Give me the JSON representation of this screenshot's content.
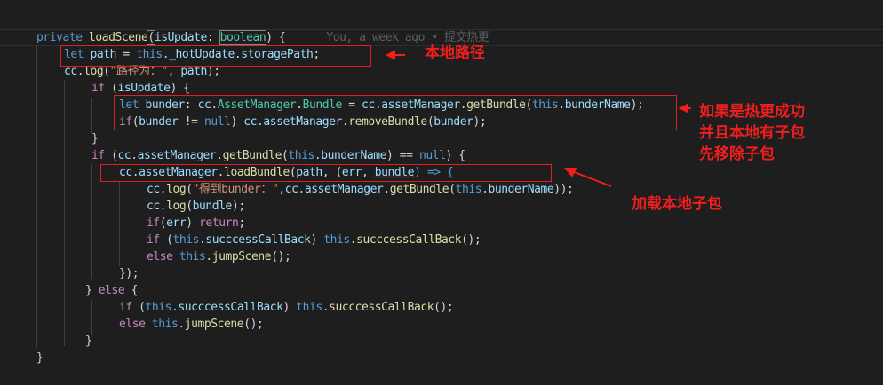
{
  "editor": {
    "blame": "You, a week ago • 提交热更",
    "lines": {
      "l1": {
        "kw": "private",
        "fn": "loadScene",
        "param": "isUpdate",
        "colon": ": ",
        "type": "boolean",
        "end": ") {"
      },
      "l2": {
        "kw": "let",
        "var": "path",
        "eq": " = ",
        "this": "this",
        "prop": "._hotUpdate.storagePath",
        "end": ";"
      },
      "l3": {
        "obj": "cc",
        "fn": ".log",
        "open": "(",
        "str": "\"路径为：\"",
        "mid": ", ",
        "arg": "path",
        "end": ");"
      },
      "l4": {
        "kw": "if",
        "open": " (",
        "arg": "isUpdate",
        "end": ") {"
      },
      "l5": {
        "kw": "let",
        "var": "bunder",
        "colon": ": ",
        "obj": "cc",
        "type1": "AssetManager",
        "type2": "Bundle",
        "eq": " = ",
        "obj2": "cc",
        "prop": ".assetManager",
        "fn": "getBundle",
        "this": "this",
        "prop2": ".bunderName",
        "end": ");"
      },
      "l6": {
        "kw": "if",
        "open": "(",
        "arg": "bunder",
        "op": " != ",
        "null": "null",
        "close": ") ",
        "obj": "cc",
        "prop": ".assetManager",
        "fn": "removeBundle",
        "arg2": "bunder",
        "end": ");"
      },
      "l7": {
        "end": "}"
      },
      "l8": {
        "kw": "if",
        "open": " (",
        "obj": "cc",
        "prop": ".assetManager",
        "fn": "getBundle",
        "this": "this",
        "prop2": ".bunderName",
        "op": ") == ",
        "null": "null",
        "end": ") {"
      },
      "l9": {
        "obj": "cc",
        "prop": ".assetManager",
        "fn": "loadBundle",
        "arg": "path",
        "mid": ", (",
        "err": "err",
        "comma": ", ",
        "bundle": "bundle",
        "arrow": ") => {"
      },
      "l10": {
        "obj": "cc",
        "fn": ".log",
        "str": "\"得到bunder：\"",
        "comma": ",",
        "obj2": "cc",
        "prop": ".assetManager",
        "fn2": "getBundle",
        "this": "this",
        "prop2": ".bunderName",
        "end": "));"
      },
      "l11": {
        "obj": "cc",
        "fn": ".log",
        "arg": "bundle",
        "end": ");"
      },
      "l12": {
        "kw": "if",
        "arg": "err",
        "ret": "return",
        "end": ";"
      },
      "l13": {
        "kw": "if",
        "this": "this",
        "prop": ".succcessCallBack",
        "this2": "this",
        "fn": ".succcessCallBack",
        "end": "();"
      },
      "l14": {
        "kw": "else",
        "this": "this",
        "fn": ".jumpScene",
        "end": "();"
      },
      "l15": {
        "end": "});"
      },
      "l16": {
        "close": "} ",
        "kw": "else",
        "end": " {"
      },
      "l17": {
        "kw": "if",
        "this": "this",
        "prop": ".succcessCallBack",
        "this2": "this",
        "fn": ".succcessCallBack",
        "end": "();"
      },
      "l18": {
        "kw": "else",
        "this": "this",
        "fn": ".jumpScene",
        "end": "();"
      },
      "l19": {
        "end": "}"
      },
      "l20": {
        "end": "}"
      }
    }
  },
  "annotations": {
    "local_path": "本地路径",
    "remove_bundle": [
      "如果是热更成功",
      "并且本地有子包",
      "先移除子包"
    ],
    "load_bundle": "加载本地子包"
  },
  "colors": {
    "background": "#1e1e1e",
    "annotation": "#f01e1e",
    "keyword": "#569cd6",
    "control": "#c586c0",
    "identifier": "#9cdcfe",
    "function": "#dcdcaa",
    "type": "#4ec9b0",
    "string": "#ce9178"
  }
}
